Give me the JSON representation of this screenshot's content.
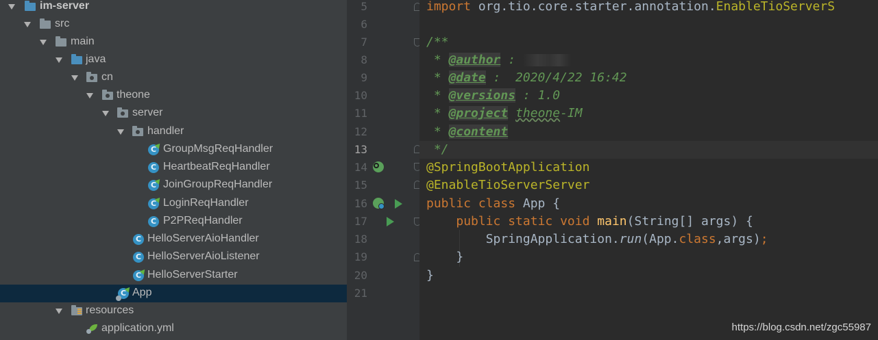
{
  "tree": {
    "root": "im-server",
    "src": "src",
    "main": "main",
    "java": "java",
    "cn": "cn",
    "theone": "theone",
    "server": "server",
    "handler": "handler",
    "handler_files": [
      "GroupMsgReqHandler",
      "HeartbeatReqHandler",
      "JoinGroupReqHandler",
      "LoginReqHandler",
      "P2PReqHandler"
    ],
    "server_files": [
      "HelloServerAioHandler",
      "HelloServerAioListener",
      "HelloServerStarter"
    ],
    "selected_file": "App",
    "resources": "resources",
    "yml": "application.yml"
  },
  "gutter": {
    "line_numbers": [
      "5",
      "6",
      "7",
      "8",
      "9",
      "10",
      "11",
      "12",
      "13",
      "14",
      "15",
      "16",
      "17",
      "18",
      "19",
      "20",
      "21"
    ],
    "current_line": "13"
  },
  "code": {
    "l5_kw": "import",
    "l5_rest": " org.tio.core.starter.annotation.",
    "l5_cls": "EnableTioServerS",
    "l7": "/**",
    "star": " * ",
    "author_tag": "@author",
    "author_rest": " : ",
    "date_tag": "@date",
    "date_rest": " :  2020/4/22 16:42",
    "versions_tag": "@versions",
    "versions_rest": " : 1.0",
    "project_tag": "@project",
    "project_name": "theone",
    "project_rest": "-IM",
    "content_tag": "@content",
    "l13": " */",
    "l14": "@SpringBootApplication",
    "l15": "@EnableTioServerServer",
    "l16_kw": "public class",
    "l16_rest": " App {",
    "l17_kw": "public static void",
    "l17_method": "main",
    "l17_rest": "(String[] args) {",
    "l18_a": "SpringApplication.",
    "l18_run": "run",
    "l18_b": "(App.",
    "l18_class": "class",
    "l18_c": ",args)",
    "l18_semi": ";",
    "l19": "}",
    "l20": "}"
  },
  "watermark": "https://blog.csdn.net/zgc55987",
  "colors": {
    "tree_bg": "#3c3f41",
    "selection": "#0d293e",
    "editor_bg": "#2b2b2b",
    "keyword": "#cc7832",
    "annotation": "#bbb529",
    "javadoc": "#629755",
    "method": "#ffc66d"
  }
}
